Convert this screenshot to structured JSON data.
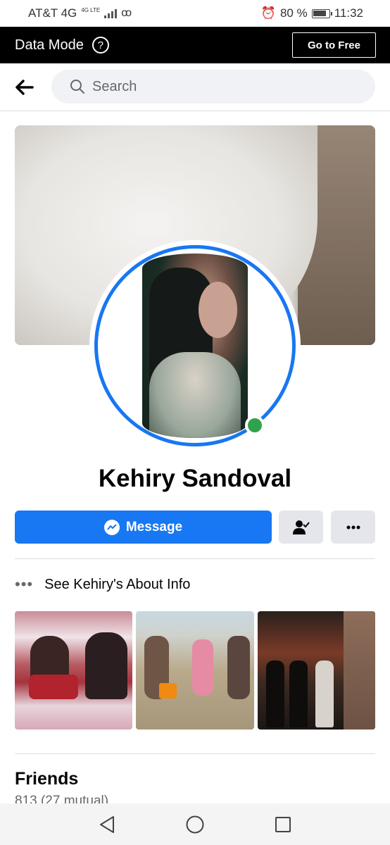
{
  "status_bar": {
    "carrier": "AT&T 4G",
    "network_badge": "4G LTE",
    "battery": "80 %",
    "time": "11:32"
  },
  "data_bar": {
    "label": "Data Mode",
    "help": "?",
    "cta": "Go to Free"
  },
  "search": {
    "placeholder": "Search"
  },
  "profile": {
    "name": "Kehiry Sandoval",
    "online": true
  },
  "actions": {
    "message_label": "Message"
  },
  "about": {
    "label": "See Kehiry's About Info"
  },
  "friends": {
    "title": "Friends",
    "count": "813 (27 mutual)"
  },
  "colors": {
    "accent": "#1877f2",
    "online": "#31a24c",
    "button_gray": "#e4e6eb"
  }
}
